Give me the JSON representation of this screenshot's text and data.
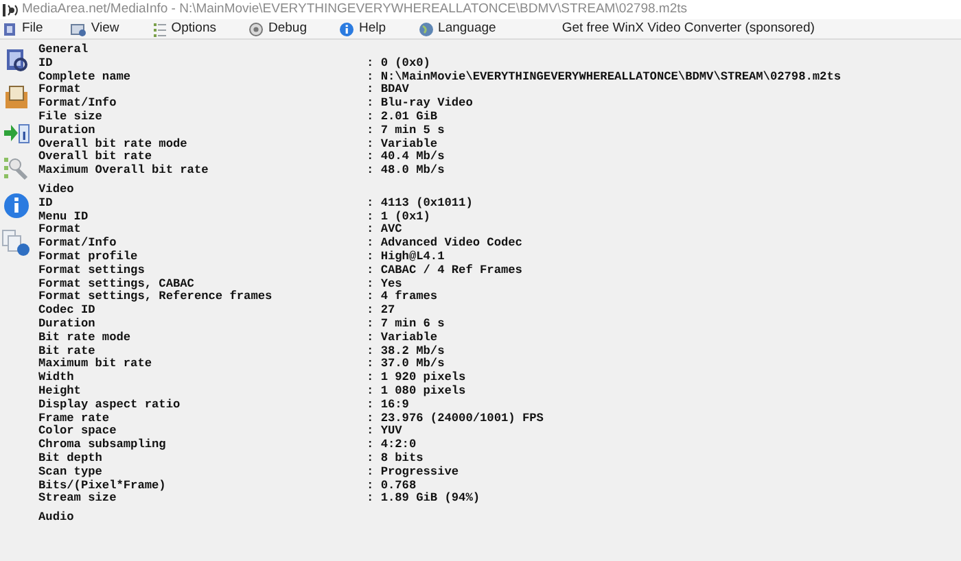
{
  "window": {
    "title": "MediaArea.net/MediaInfo - N:\\MainMovie\\EVERYTHINGEVERYWHEREALLATONCE\\BDMV\\STREAM\\02798.m2ts"
  },
  "menu": [
    {
      "label": "File",
      "kind": "file"
    },
    {
      "label": "View",
      "kind": "view"
    },
    {
      "label": "Options",
      "kind": "options"
    },
    {
      "label": "Debug",
      "kind": "debug"
    },
    {
      "label": "Help",
      "kind": "help"
    },
    {
      "label": "Language",
      "kind": "language"
    },
    {
      "label": "Get free WinX Video Converter (sponsored)",
      "kind": "link"
    }
  ],
  "sections": [
    {
      "title": "General",
      "fields": [
        {
          "label": "ID",
          "value": ": 0 (0x0)"
        },
        {
          "label": "Complete name",
          "value": ": N:\\MainMovie\\EVERYTHINGEVERYWHEREALLATONCE\\BDMV\\STREAM\\02798.m2ts"
        },
        {
          "label": "Format",
          "value": ": BDAV"
        },
        {
          "label": "Format/Info",
          "value": ": Blu-ray Video"
        },
        {
          "label": "File size",
          "value": ": 2.01 GiB"
        },
        {
          "label": "Duration",
          "value": ": 7 min 5 s"
        },
        {
          "label": "Overall bit rate mode",
          "value": ": Variable"
        },
        {
          "label": "Overall bit rate",
          "value": ": 40.4 Mb/s"
        },
        {
          "label": "Maximum Overall bit rate",
          "value": ": 48.0 Mb/s"
        }
      ]
    },
    {
      "title": "Video",
      "fields": [
        {
          "label": "ID",
          "value": ": 4113 (0x1011)"
        },
        {
          "label": "Menu ID",
          "value": ": 1 (0x1)"
        },
        {
          "label": "Format",
          "value": ": AVC"
        },
        {
          "label": "Format/Info",
          "value": ": Advanced Video Codec"
        },
        {
          "label": "Format profile",
          "value": ": High@L4.1"
        },
        {
          "label": "Format settings",
          "value": ": CABAC / 4 Ref Frames"
        },
        {
          "label": "Format settings, CABAC",
          "value": ": Yes"
        },
        {
          "label": "Format settings, Reference frames",
          "value": ": 4 frames"
        },
        {
          "label": "Codec ID",
          "value": ": 27"
        },
        {
          "label": "Duration",
          "value": ": 7 min 6 s"
        },
        {
          "label": "Bit rate mode",
          "value": ": Variable"
        },
        {
          "label": "Bit rate",
          "value": ": 38.2 Mb/s"
        },
        {
          "label": "Maximum bit rate",
          "value": ": 37.0 Mb/s"
        },
        {
          "label": "Width",
          "value": ": 1 920 pixels"
        },
        {
          "label": "Height",
          "value": ": 1 080 pixels"
        },
        {
          "label": "Display aspect ratio",
          "value": ": 16:9"
        },
        {
          "label": "Frame rate",
          "value": ": 23.976 (24000/1001) FPS"
        },
        {
          "label": "Color space",
          "value": ": YUV"
        },
        {
          "label": "Chroma subsampling",
          "value": ": 4:2:0"
        },
        {
          "label": "Bit depth",
          "value": ": 8 bits"
        },
        {
          "label": "Scan type",
          "value": ": Progressive"
        },
        {
          "label": "Bits/(Pixel*Frame)",
          "value": ": 0.768"
        },
        {
          "label": "Stream size",
          "value": ": 1.89 GiB (94%)"
        }
      ]
    },
    {
      "title": "Audio"
    }
  ]
}
